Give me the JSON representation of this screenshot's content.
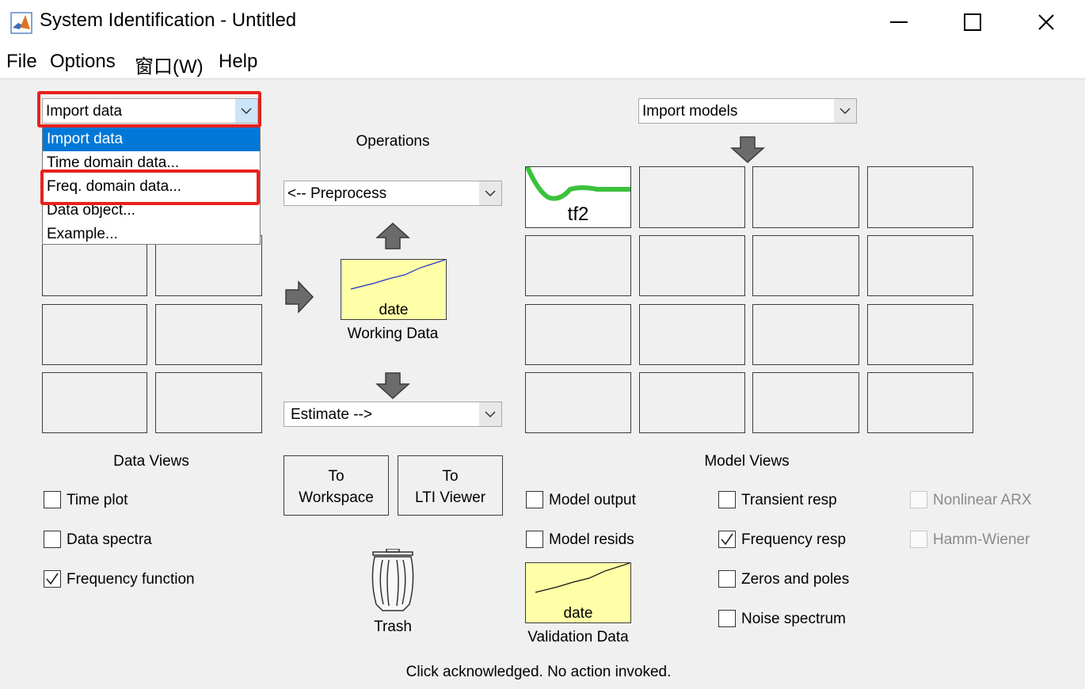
{
  "window": {
    "title": "System Identification - Untitled"
  },
  "menu": [
    "File",
    "Options",
    "窗口(W)",
    "Help"
  ],
  "import_data": {
    "selected": "Import data",
    "options": [
      "Import data",
      "Time domain data...",
      "Freq. domain data...",
      "Data object...",
      "Example..."
    ],
    "highlighted_option": "Freq. domain data..."
  },
  "import_models": {
    "selected": "Import models"
  },
  "operations": {
    "label": "Operations",
    "preprocess": "<-- Preprocess",
    "estimate": "Estimate -->",
    "working_data": {
      "name": "date",
      "caption": "Working Data"
    }
  },
  "models": {
    "tile1": "tf2"
  },
  "buttons": {
    "to_workspace": [
      "To",
      "Workspace"
    ],
    "to_lti_viewer": [
      "To",
      "LTI Viewer"
    ]
  },
  "trash": {
    "label": "Trash"
  },
  "validation_data": {
    "name": "date",
    "caption": "Validation Data"
  },
  "data_views": {
    "title": "Data Views",
    "options": [
      {
        "label": "Time plot",
        "checked": false
      },
      {
        "label": "Data spectra",
        "checked": false
      },
      {
        "label": "Frequency function",
        "checked": true
      }
    ]
  },
  "model_views": {
    "title": "Model Views",
    "col1": [
      {
        "label": "Model output",
        "checked": false
      },
      {
        "label": "Model resids",
        "checked": false
      }
    ],
    "col2": [
      {
        "label": "Transient resp",
        "checked": false
      },
      {
        "label": "Frequency resp",
        "checked": true
      },
      {
        "label": "Zeros and poles",
        "checked": false
      },
      {
        "label": "Noise spectrum",
        "checked": false
      }
    ],
    "col3": [
      {
        "label": "Nonlinear ARX",
        "checked": false,
        "enabled": false
      },
      {
        "label": "Hamm-Wiener",
        "checked": false,
        "enabled": false
      }
    ]
  },
  "status": "Click acknowledged. No action invoked.",
  "colors": {
    "highlight_red": "#e8211c",
    "selection_blue": "#0078d7",
    "yellow_tile": "#ffffa8",
    "model_line_green": "#3cc23c"
  }
}
